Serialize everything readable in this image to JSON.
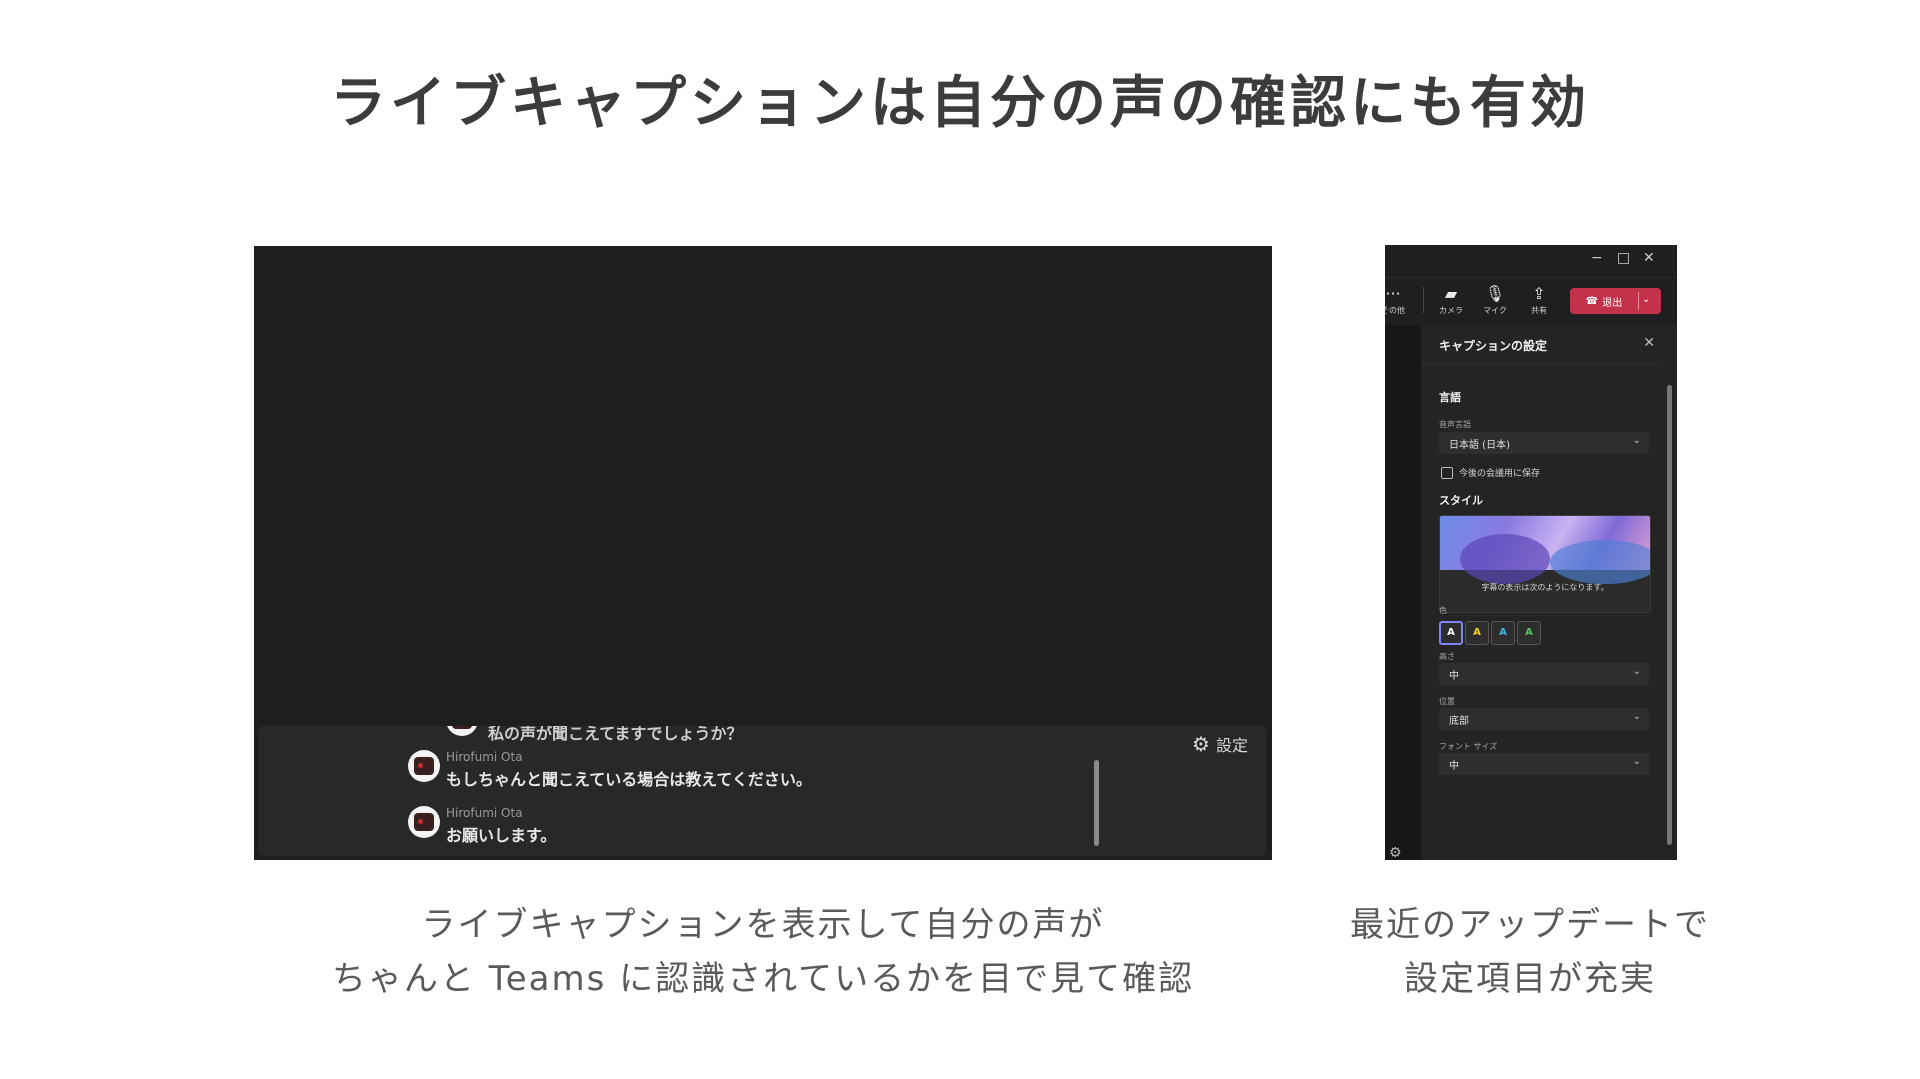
{
  "slide": {
    "title": "ライブキャプションは自分の声の確認にも有効",
    "left_caption": [
      "ライブキャプションを表示して自分の声が",
      "ちゃんと Teams に認識されているかを目で見て確認"
    ],
    "right_caption": [
      "最近のアップデートで",
      "設定項目が充実"
    ]
  },
  "captions": {
    "partial_text": "私の声が聞こえてますでしょうか？",
    "entries": [
      {
        "name": "Hirofumi Ota",
        "text": "もしちゃんと聞こえている場合は教えてください。"
      },
      {
        "name": "Hirofumi Ota",
        "text": "お願いします。"
      }
    ],
    "settings_label": "設定",
    "icons": {
      "settings": "gear-icon",
      "avatar": "avatar"
    }
  },
  "teams": {
    "window_controls": {
      "minimize": "−",
      "maximize": "□",
      "close": "✕"
    },
    "toolbar": {
      "more_label": "その他",
      "camera_label": "カメラ",
      "mic_label": "マイク",
      "share_label": "共有",
      "leave_label": "退出"
    },
    "pane": {
      "title": "キャプションの設定",
      "language_section": "言語",
      "spoken_language_label": "音声言語",
      "spoken_language_value": "日本語 (日本)",
      "save_checkbox_label": "今後の会議用に保存",
      "style_section": "スタイル",
      "preview_text": "字幕の表示は次のようになります。",
      "color_label": "色",
      "color_swatches": [
        {
          "letter": "A",
          "color": "#ffffff"
        },
        {
          "letter": "A",
          "color": "#f2d01b"
        },
        {
          "letter": "A",
          "color": "#3fb8e8"
        },
        {
          "letter": "A",
          "color": "#56c45a"
        }
      ],
      "height_label": "高さ",
      "height_value": "中",
      "position_label": "位置",
      "position_value": "底部",
      "font_size_label": "フォント サイズ",
      "font_size_value": "中"
    },
    "colors": {
      "leave_button": "#c4314b",
      "accent": "#7f85f5"
    }
  }
}
